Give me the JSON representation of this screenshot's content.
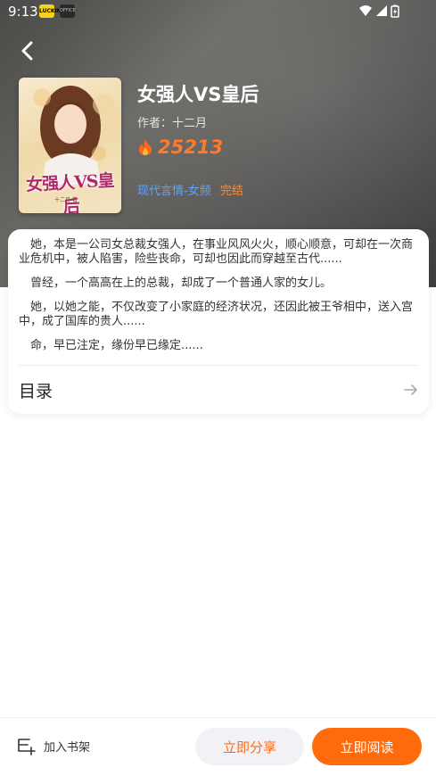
{
  "status_bar": {
    "time": "9:13",
    "app_icon_1": "LUCKIN",
    "app_icon_2": "OFFICE"
  },
  "book": {
    "cover_title": "女强人VS皇后",
    "cover_author": "十二月 著",
    "title": "女强人VS皇后",
    "author": "作者：十二月",
    "heat": "25213",
    "category": "现代言情-女频",
    "status": "完结"
  },
  "synopsis": [
    "她，本是一公司女总裁女强人，在事业风风火火，顺心顺意，可却在一次商业危机中，被人陷害，险些丧命，可却也因此而穿越至古代......",
    "曾经，一个高高在上的总裁，却成了一个普通人家的女儿。",
    "她，以她之能，不仅改变了小家庭的经济状况，还因此被王爷相中，送入宫中，成了国库的贵人......",
    "命，早已注定，缘份早已缘定......"
  ],
  "toc": {
    "label": "目录"
  },
  "bottom_bar": {
    "add_shelf_label": "加入书架",
    "share_label": "立即分享",
    "read_label": "立即阅读"
  },
  "colors": {
    "accent": "#ff6a0d",
    "category": "#5aa6ff",
    "heat": "#ff7a2a"
  },
  "icons": [
    "back-arrow-icon",
    "flame-icon",
    "arrow-right-icon",
    "bookshelf-add-icon",
    "wifi-icon",
    "signal-icon",
    "battery-icon"
  ]
}
